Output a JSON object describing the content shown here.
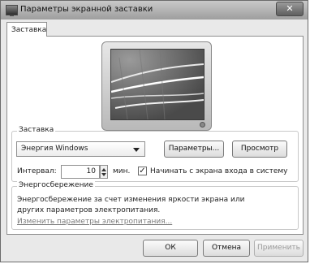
{
  "window": {
    "title": "Параметры экранной заставки",
    "close_glyph": "✕"
  },
  "tabs": [
    {
      "label": "Заставка"
    }
  ],
  "screensaver": {
    "group_label": "Заставка",
    "selected": "Энергия Windows",
    "settings_button": "Параметры...",
    "preview_button": "Просмотр",
    "interval_label": "Интервал:",
    "interval_value": "10",
    "interval_unit": "мин.",
    "resume_checkbox_checked": true,
    "resume_label": "Начинать с экрана входа в систему"
  },
  "power": {
    "group_label": "Энергосбережение",
    "description": "Энергосбережение за счет изменения яркости экрана или других параметров электропитания.",
    "link": "Изменить параметры электропитания..."
  },
  "buttons": {
    "ok": "ОК",
    "cancel": "Отмена",
    "apply": "Применить"
  },
  "icons": {
    "app": "monitor-icon",
    "close": "close-icon",
    "dropdown": "chevron-down-icon",
    "spin_up": "spin-up-icon",
    "spin_down": "spin-down-icon",
    "check": "checkmark-icon"
  }
}
